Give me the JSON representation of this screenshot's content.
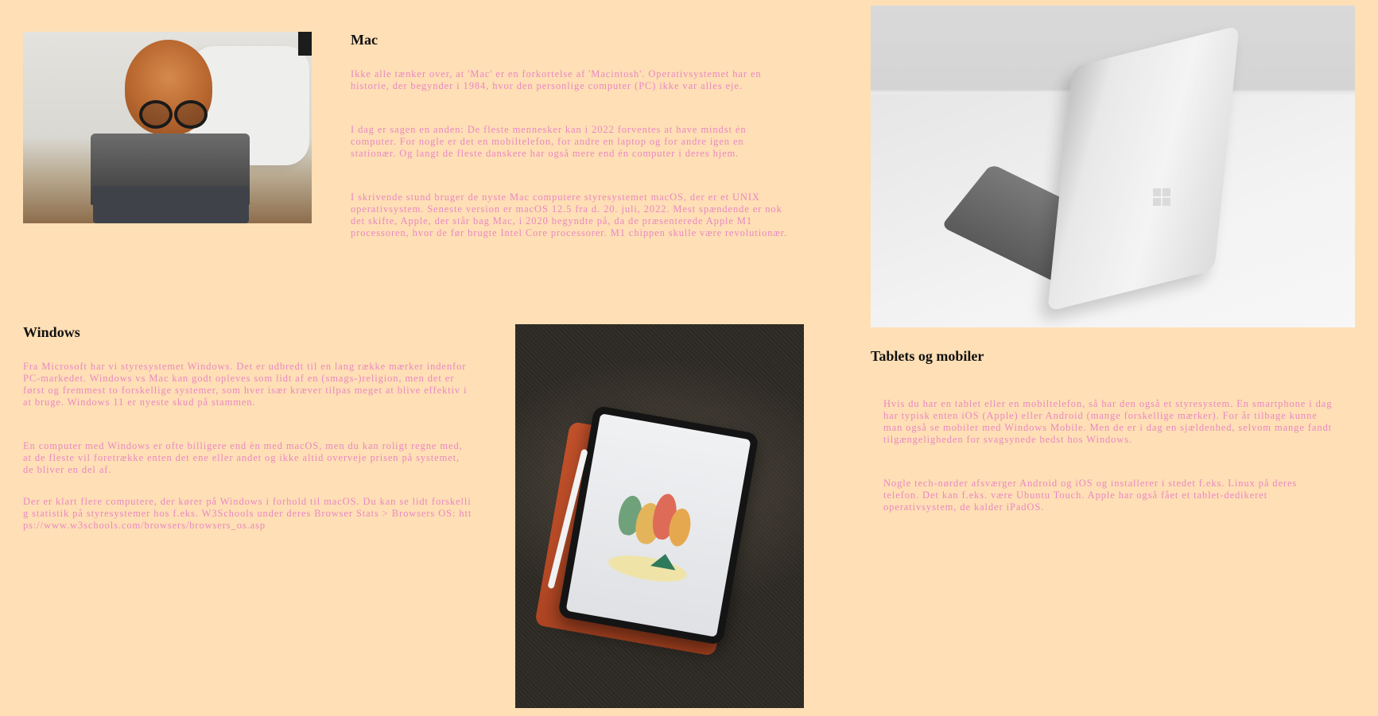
{
  "colors": {
    "background": "#ffdfb5",
    "heading": "#111111",
    "body_text": "#e888c4"
  },
  "mac": {
    "heading": "Mac",
    "image": "dog-with-glasses-using-tablet",
    "paragraphs": [
      "Ikke alle tænker over, at 'Mac' er en forkortelse af 'Macintosh'. Operativsystemet har en historie, der begynder i 1984, hvor den personlige computer (PC) ikke var alles eje.",
      "I dag er sagen en anden: De fleste mennesker kan i 2022 forventes at have mindst én computer. For nogle er det en mobiltelefon, for andre en laptop og for andre igen en stationær. Og langt de fleste danskere har også mere end én computer i deres hjem.",
      "I skrivende stund bruger de nyste Mac computere styresystemet macOS, der er et UNIX operativsystem. Seneste version er macOS 12.5 fra d. 20. juli, 2022. Mest spændende er nok det skifte, Apple, der står bag Mac, i 2020 begyndte på, da de præsenterede Apple M1 processoren, hvor de før brugte Intel Core processorer. M1 chippen skulle være revolutionær."
    ]
  },
  "windows": {
    "heading": "Windows",
    "image": "tablet-on-red-case",
    "paragraphs": [
      "Fra Microsoft har vi styresystemet Windows. Det er udbredt til en lang række mærker indenfor PC-markedet. Windows vs Mac kan godt opleves som lidt af en (smags-)religion, men det er først og fremmest to forskellige systemer, som hver især kræver tilpas meget at blive effektiv i at bruge. Windows 11 er nyeste skud på stammen.",
      "En computer med Windows er ofte billigere end èn med macOS, men du kan roligt regne med, at de fleste vil foretrække enten det ene eller andet og ikke altid overveje prisen på systemet, de bliver en del af.",
      "Der er klart flere computere, der kører på Windows i forhold til macOS. Du kan se lidt forskellig statistik på styresystemer hos f.eks. W3Schools under deres Browser Stats > Browsers OS: https://www.w3schools.com/browsers/browsers_os.asp"
    ]
  },
  "tablets": {
    "heading": "Tablets og mobiler",
    "image": "silver-laptop-on-desk",
    "paragraphs": [
      "Hvis du har en tablet eller en mobiltelefon, så har den også et styresystem. En smartphone i dag har typisk enten iOS (Apple) eller Android (mange forskellige mærker). For år tilbage kunne man også se mobiler med Windows Mobile. Men de er i dag en sjældenhed, selvom mange fandt tilgængeligheden for svagsynede bedst hos Windows.",
      "Nogle tech-nørder afsværger Android og iOS og installerer i stedet f.eks. Linux på deres telefon. Det kan f.eks. være Ubuntu Touch. Apple har også fået et tablet-dedikeret operativsystem, de kalder iPadOS."
    ]
  }
}
